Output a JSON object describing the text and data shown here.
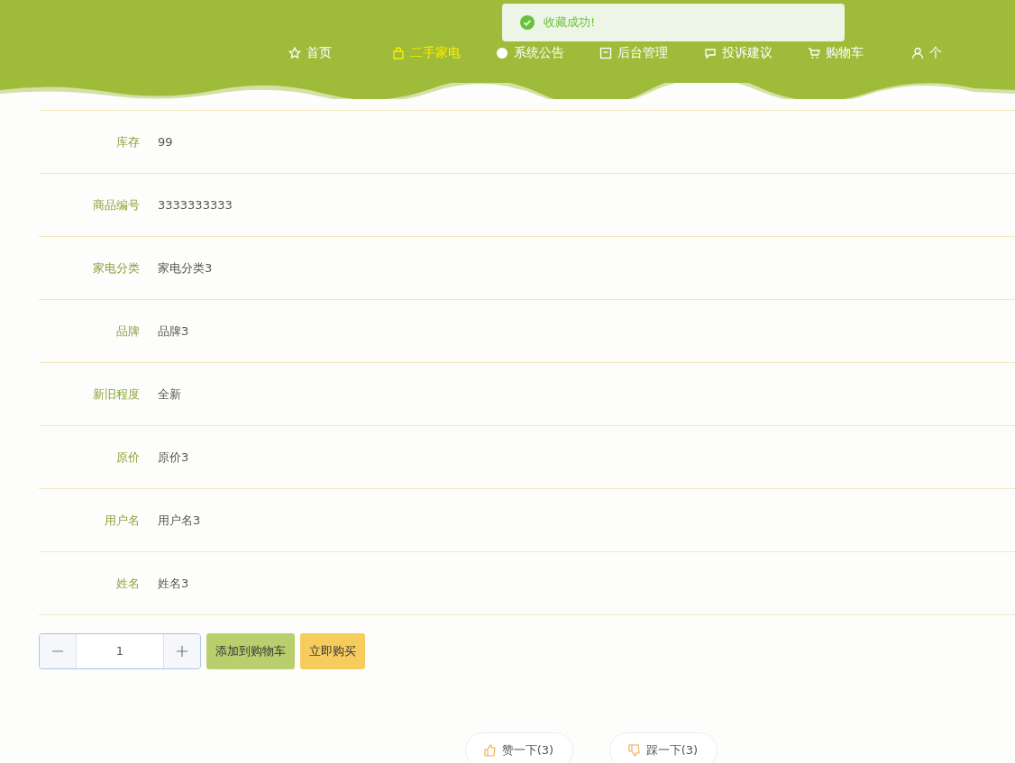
{
  "header": {
    "nav": [
      {
        "label": "首页",
        "selected": false
      },
      {
        "label": "二手家电",
        "selected": true
      },
      {
        "label": "系统公告",
        "selected": false
      },
      {
        "label": "后台管理",
        "selected": false
      },
      {
        "label": "投诉建议",
        "selected": false
      },
      {
        "label": "购物车",
        "selected": false
      },
      {
        "label": "个",
        "selected": false
      }
    ]
  },
  "toast": {
    "message": "收藏成功!"
  },
  "details": [
    {
      "label": "库存",
      "value": "99"
    },
    {
      "label": "商品编号",
      "value": "3333333333"
    },
    {
      "label": "家电分类",
      "value": "家电分类3"
    },
    {
      "label": "品牌",
      "value": "品牌3"
    },
    {
      "label": "新旧程度",
      "value": "全新"
    },
    {
      "label": "原价",
      "value": "原价3"
    },
    {
      "label": "用户名",
      "value": "用户名3"
    },
    {
      "label": "姓名",
      "value": "姓名3"
    }
  ],
  "quantity": {
    "value": "1"
  },
  "actions": [
    {
      "label": "添加到购物车",
      "kind": "cart"
    },
    {
      "label": "立即购买",
      "kind": "buy"
    }
  ],
  "votes": [
    {
      "label": "赞一下(3)",
      "kind": "up"
    },
    {
      "label": "踩一下(3)",
      "kind": "down"
    }
  ]
}
